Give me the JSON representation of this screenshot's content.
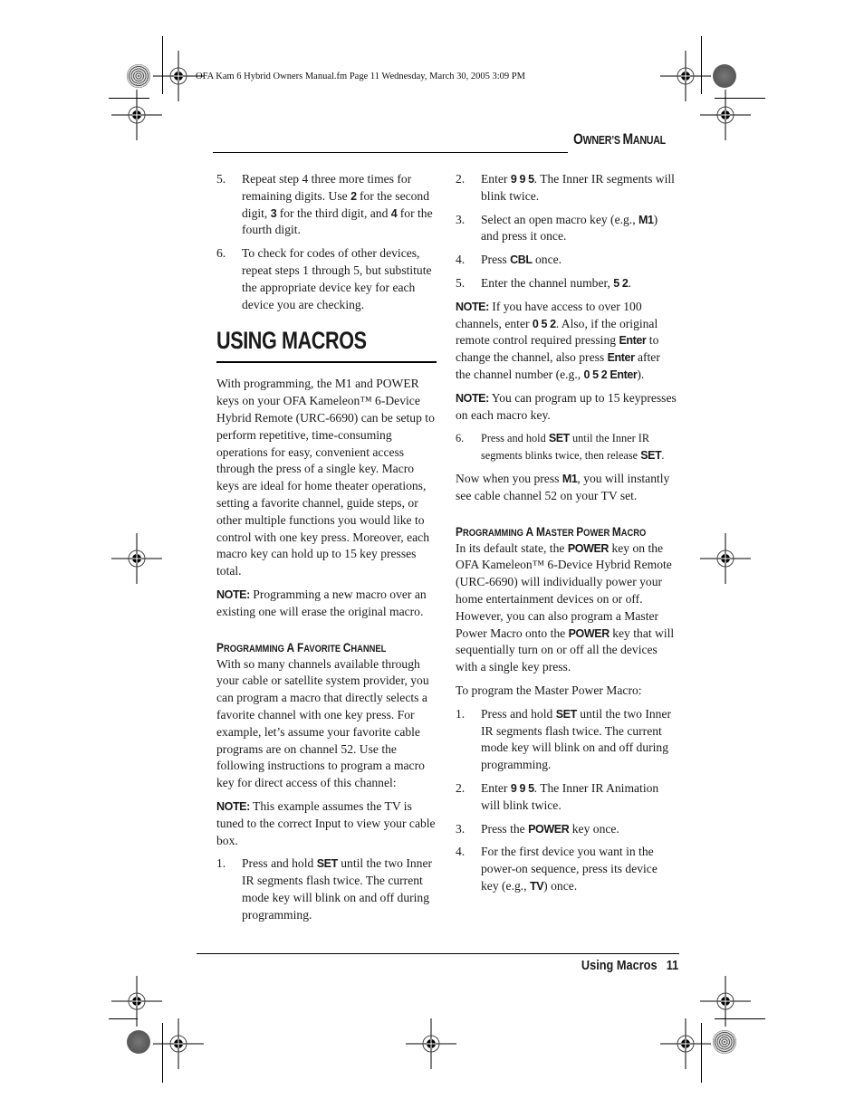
{
  "slug": "OFA Kam 6 Hybrid Owners Manual.fm  Page 11  Wednesday, March 30, 2005  3:09 PM",
  "running_head": {
    "first_o": "O",
    "rest_1": "WNER’S ",
    "first_m": "M",
    "rest_2": "ANUAL"
  },
  "left_column": {
    "step5": {
      "num": "5.",
      "t1": "Repeat step 4 three more times for remaining digits. Use ",
      "k1": "2",
      "t2": " for the second digit, ",
      "k2": "3",
      "t3": " for the third digit, and ",
      "k3": "4",
      "t4": " for the fourth digit."
    },
    "step6": {
      "num": "6.",
      "text": "To check for codes of other devices, repeat steps 1 through 5, but substitute the appropriate device key for each device you are checking."
    },
    "heading": "USING MACROS",
    "intro": "With programming, the M1 and POWER keys on your OFA Kameleon™ 6-Device Hybrid Remote (URC-6690) can be setup to perform repetitive, time-consuming operations for easy, convenient access through the press of a single key.   Macro keys are ideal for home theater operations, setting a favorite channel, guide steps, or other multiple functions you would like to control with one key press. Moreover, each macro key can hold up to 15 key presses total.",
    "note1": {
      "label": "NOTE:",
      "text": "  Programming a new macro over an existing one will erase the original macro."
    },
    "subheading": {
      "a": "P",
      "b": "ROGRAMMING ",
      "c": "A F",
      "d": "AVORITE ",
      "e": "C",
      "f": "HANNEL"
    },
    "fav_intro": "With so many channels available through your cable or satellite system provider, you can program a macro that directly selects a favorite channel with one key press. For example, let’s assume your favorite cable programs are on channel 52. Use the following instructions to program a macro key for direct access of this channel:",
    "note2": {
      "label": "NOTE:",
      "text": " This example assumes the TV is tuned to the correct Input to view your cable box."
    },
    "step1": {
      "num": "1.",
      "t1": "Press and hold ",
      "k1": "SET",
      "t2": " until the two Inner IR segments flash twice. The current mode key will blink on and off during programming."
    }
  },
  "right_column": {
    "step2": {
      "num": "2.",
      "t1": "Enter ",
      "k1": "9 9 5",
      "t2": ". The Inner IR segments will blink twice."
    },
    "step3": {
      "num": "3.",
      "t1": "Select an open macro key (e.g., ",
      "k1": "M1",
      "t2": ") and press it once."
    },
    "step4": {
      "num": "4.",
      "t1": "Press ",
      "k1": "CBL",
      "t2": " once."
    },
    "step5": {
      "num": "5.",
      "t1": "Enter the channel number, ",
      "k1": "5 2",
      "t2": "."
    },
    "note3": {
      "label": "NOTE:",
      "t1": " If you have access to over 100 channels, enter ",
      "k1": "0 5 2",
      "t2": ". Also, if the original remote control required pressing ",
      "k2": "Enter",
      "t3": " to change the channel, also press ",
      "k3": "Enter",
      "t4": " after the channel number (e.g., ",
      "k4": "0 5 2 Enter",
      "t5": ")."
    },
    "note4": {
      "label": "NOTE:",
      "text": " You can program up to 15 keypresses on each macro key."
    },
    "step6": {
      "num": "6.",
      "t1": "Press and hold ",
      "k1": "SET",
      "t2": " until the Inner IR segments blinks twice, then release ",
      "k2": "SET",
      "t3": "."
    },
    "result": {
      "t1": "Now when you press ",
      "k1": "M1",
      "t2": ", you will instantly see cable channel 52 on your TV set."
    },
    "subheading": {
      "a": "P",
      "b": "ROGRAMMING ",
      "c": "A M",
      "d": "ASTER ",
      "e": "P",
      "f": "OWER ",
      "g": "M",
      "h": "ACRO"
    },
    "power_intro": {
      "t1": "In its default state, the ",
      "k1": "POWER",
      "t2": " key on the OFA Kameleon™ 6-Device Hybrid Remote (URC-6690) will individually power your home entertainment devices on or off. However, you can also program a Master Power Macro onto the ",
      "k2": "POWER",
      "t3": " key that will sequentially turn on or off all the devices with a single key press."
    },
    "to_program": "To program the Master Power Macro:",
    "mp_step1": {
      "num": "1.",
      "t1": "Press and hold ",
      "k1": "SET",
      "t2": " until the two Inner IR segments flash twice. The current mode key will blink on and off during programming."
    },
    "mp_step2": {
      "num": "2.",
      "t1": "Enter ",
      "k1": "9 9 5",
      "t2": ". The Inner IR Animation will blink twice."
    },
    "mp_step3": {
      "num": "3.",
      "t1": "Press the ",
      "k1": "POWER",
      "t2": " key once."
    },
    "mp_step4": {
      "num": "4.",
      "t1": "For the first device you want in the power-on sequence, press its device key (e.g., ",
      "k1": "TV",
      "t2": ") once."
    }
  },
  "footer": {
    "section": "Using Macros",
    "page": "11"
  }
}
